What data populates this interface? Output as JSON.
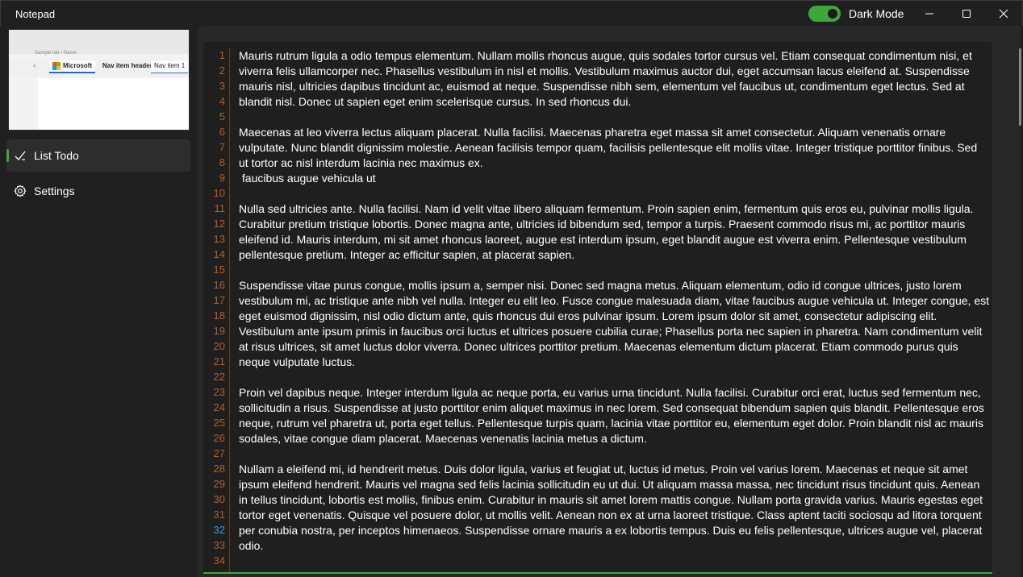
{
  "window": {
    "title": "Notepad",
    "controls": {
      "minimize_icon": "minimize-icon",
      "maximize_icon": "maximize-icon",
      "close_icon": "close-icon"
    }
  },
  "header": {
    "dark_mode_label": "Dark Mode",
    "dark_mode_on": true,
    "toggle_color": "#3fa73a"
  },
  "sidebar": {
    "thumbnail": {
      "caption": "Sample tab • Name",
      "tabs": [
        "Microsoft",
        "Nav item header",
        "Nav item 1"
      ]
    },
    "items": [
      {
        "label": "List Todo",
        "icon": "checkmark-icon",
        "active": true
      },
      {
        "label": "Settings",
        "icon": "gear-icon",
        "active": false
      }
    ]
  },
  "editor": {
    "current_line": 32,
    "accent_color": "#3fa73a",
    "line_number_color": "#b0602a",
    "line_numbers": [
      "1",
      "2",
      "3",
      "4",
      "5",
      "6",
      "7",
      "8",
      "9",
      "10",
      "11",
      "12",
      "13",
      "14",
      "15",
      "16",
      "17",
      "18",
      "19",
      "20",
      "21",
      "22",
      "23",
      "24",
      "25",
      "26",
      "27",
      "28",
      "29",
      "30",
      "31",
      "32",
      "33",
      "34"
    ],
    "lines": [
      "Mauris rutrum ligula a odio tempus elementum. Nullam mollis rhoncus augue, quis sodales tortor cursus vel. Etiam consequat condimentum nisi, et",
      "viverra felis ullamcorper nec. Phasellus vestibulum in nisl et mollis. Vestibulum maximus auctor dui, eget accumsan lacus eleifend at. Suspendisse",
      "mauris nisl, ultricies dapibus tincidunt ac, euismod at neque. Suspendisse nibh sem, elementum vel faucibus ut, condimentum eget lectus. Sed at",
      "blandit nisl. Donec ut sapien eget enim scelerisque cursus. In sed rhoncus dui.",
      "",
      "Maecenas at leo viverra lectus aliquam placerat. Nulla facilisi. Maecenas pharetra eget massa sit amet consectetur. Aliquam venenatis ornare",
      "vulputate. Nunc blandit dignissim molestie. Aenean facilisis tempor quam, facilisis pellentesque elit mollis vitae. Integer tristique porttitor finibus. Sed",
      "ut tortor ac nisl interdum lacinia nec maximus ex.",
      " faucibus augue vehicula ut",
      "",
      "Nulla sed ultricies ante. Nulla facilisi. Nam id velit vitae libero aliquam fermentum. Proin sapien enim, fermentum quis eros eu, pulvinar mollis ligula.",
      "Curabitur pretium tristique lobortis. Donec magna ante, ultricies id bibendum sed, tempor a turpis. Praesent commodo risus mi, ac porttitor mauris",
      "eleifend id. Mauris interdum, mi sit amet rhoncus laoreet, augue est interdum ipsum, eget blandit augue est viverra enim. Pellentesque vestibulum",
      "pellentesque pretium. Integer ac efficitur sapien, at placerat sapien.",
      "",
      "Suspendisse vitae purus congue, mollis ipsum a, semper nisi. Donec sed magna metus. Aliquam elementum, odio id congue ultrices, justo lorem",
      "vestibulum mi, ac tristique ante nibh vel nulla. Integer eu elit leo. Fusce congue malesuada diam, vitae faucibus augue vehicula ut. Integer congue, est",
      "eget euismod dignissim, nisl odio dictum ante, quis rhoncus dui eros pulvinar ipsum. Lorem ipsum dolor sit amet, consectetur adipiscing elit.",
      "Vestibulum ante ipsum primis in faucibus orci luctus et ultrices posuere cubilia curae; Phasellus porta nec sapien in pharetra. Nam condimentum velit",
      "at risus ultrices, sit amet luctus dolor viverra. Donec ultrices porttitor pretium. Maecenas elementum dictum placerat. Etiam commodo purus quis",
      "neque vulputate luctus.",
      "",
      "Proin vel dapibus neque. Integer interdum ligula ac neque porta, eu varius urna tincidunt. Nulla facilisi. Curabitur orci erat, luctus sed fermentum nec,",
      "sollicitudin a risus. Suspendisse at justo porttitor enim aliquet maximus in nec lorem. Sed consequat bibendum sapien quis blandit. Pellentesque eros",
      "neque, rutrum vel pharetra ut, porta eget tellus. Pellentesque turpis quam, lacinia vitae porttitor eu, elementum eget dolor. Proin blandit nisl ac mauris",
      "sodales, vitae congue diam placerat. Maecenas venenatis lacinia metus a dictum.",
      "",
      "Nullam a eleifend mi, id hendrerit metus. Duis dolor ligula, varius et feugiat ut, luctus id metus. Proin vel varius lorem. Maecenas et neque sit amet",
      "ipsum eleifend hendrerit. Mauris vel magna sed felis lacinia sollicitudin eu ut dui. Ut aliquam massa massa, nec tincidunt risus tincidunt quis. Aenean",
      "in tellus tincidunt, lobortis est mollis, finibus enim. Curabitur in mauris sit amet lorem mattis congue. Nullam porta gravida varius. Mauris egestas eget",
      "tortor eget venenatis. Quisque vel posuere dolor, ut mollis velit. Aenean non ex at urna laoreet tristique. Class aptent taciti sociosqu ad litora torquent",
      "per conubia nostra, per inceptos himenaeos. Suspendisse ornare mauris a ex lobortis tempus. Duis eu felis pellentesque, ultrices augue vel, placerat",
      "odio.",
      ""
    ]
  }
}
